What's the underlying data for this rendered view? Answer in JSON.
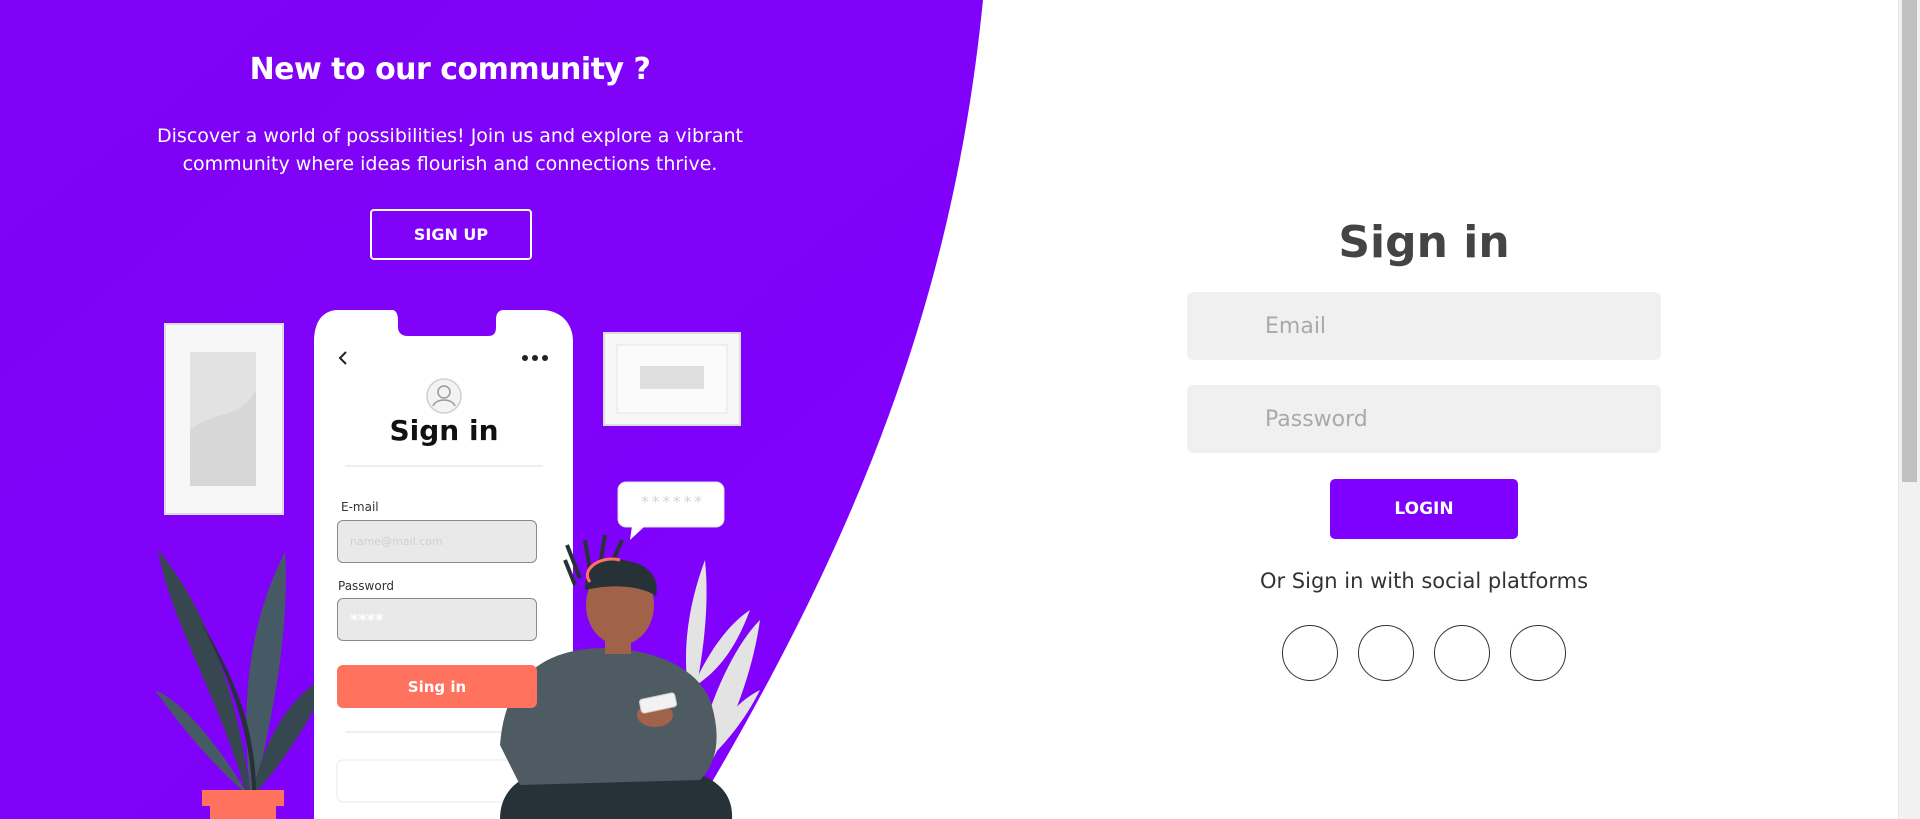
{
  "colors": {
    "brand_purple": "#7f00ff",
    "accent_coral": "#ff725e",
    "field_bg": "#f0f0f0",
    "text_dark": "#444444"
  },
  "left_panel": {
    "title": "New to our community ?",
    "description": "Discover a world of possibilities! Join us and explore a vibrant community where ideas flourish and connections thrive.",
    "signup_label": "SIGN UP"
  },
  "illustration": {
    "phone_title": "Sign in",
    "email_label": "E-mail",
    "email_placeholder": "name@mail.com",
    "password_label": "Password",
    "password_value": "****",
    "button_label": "Sing in",
    "bubble_text": "******",
    "icons": [
      "chevron-left-icon",
      "more-dots-icon",
      "user-avatar-icon"
    ]
  },
  "signin": {
    "title": "Sign in",
    "email_placeholder": "Email",
    "password_placeholder": "Password",
    "login_label": "LOGIN",
    "social_text": "Or Sign in with social platforms",
    "social_icons": [
      "social-icon-1",
      "social-icon-2",
      "social-icon-3",
      "social-icon-4"
    ]
  }
}
